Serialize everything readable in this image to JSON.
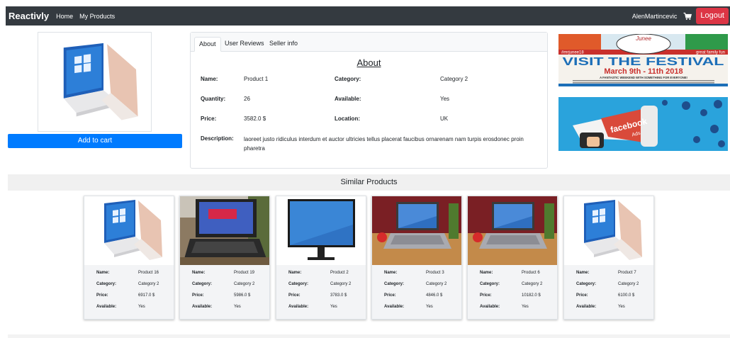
{
  "nav": {
    "brand": "Reactivly",
    "links": [
      "Home",
      "My Products"
    ],
    "username": "AlenMartincevic",
    "logout": "Logout"
  },
  "product": {
    "add_to_cart": "Add to cart",
    "tabs": [
      "About",
      "User Reviews",
      "Seller info"
    ],
    "about_title": "About",
    "fields": {
      "name_label": "Name:",
      "name": "Product 1",
      "category_label": "Category:",
      "category": "Category 2",
      "quantity_label": "Quantity:",
      "quantity": "26",
      "available_label": "Available:",
      "available": "Yes",
      "price_label": "Price:",
      "price": "3582.0 $",
      "location_label": "Location:",
      "location": "UK",
      "description_label": "Description:",
      "description": "laoreet justo ridiculus interdum et auctor ultricies tellus placerat faucibus ornarenam nam turpis erosdonec proin pharetra"
    }
  },
  "ads": {
    "ad1": {
      "top": "Junee",
      "headline": "VISIT THE FESTIVAL",
      "date": "March 9th - 11th 2018",
      "sub": "A FANTASTIC WEEKEND WITH SOMETHING FOR EVERYONE!",
      "left_tag": "#mrjunee18",
      "right_tag": "great family fun"
    },
    "ad2": {
      "text": "facebook",
      "sub": "Ads"
    }
  },
  "similar": {
    "title": "Similar Products",
    "labels": {
      "name": "Name:",
      "category": "Category:",
      "price": "Price:",
      "available": "Available:"
    },
    "items": [
      {
        "name": "Product 16",
        "category": "Category 2",
        "price": "6917.0 $",
        "available": "Yes",
        "image": "white-laptop"
      },
      {
        "name": "Product 19",
        "category": "Category 2",
        "price": "5986.0 $",
        "available": "Yes",
        "image": "black-laptop"
      },
      {
        "name": "Product 2",
        "category": "Category 2",
        "price": "3783.0 $",
        "available": "Yes",
        "image": "monitor"
      },
      {
        "name": "Product 3",
        "category": "Category 2",
        "price": "4846.0 $",
        "available": "Yes",
        "image": "silver-laptop"
      },
      {
        "name": "Product 6",
        "category": "Category 2",
        "price": "10182.0 $",
        "available": "Yes",
        "image": "silver-laptop"
      },
      {
        "name": "Product 7",
        "category": "Category 2",
        "price": "6100.0 $",
        "available": "Yes",
        "image": "white-laptop"
      }
    ]
  },
  "colors": {
    "navbar": "#343a40",
    "primary": "#007bff",
    "danger": "#dc3545"
  }
}
